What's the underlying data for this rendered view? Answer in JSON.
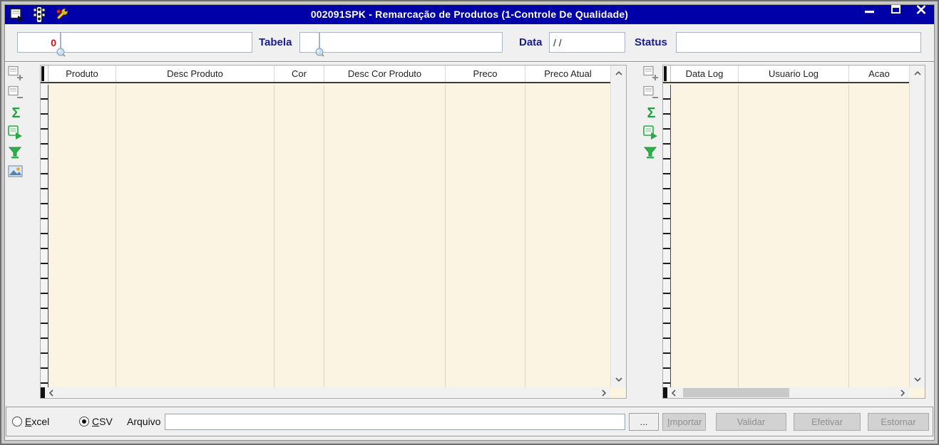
{
  "window": {
    "title": "002091SPK - Remarcação de Produtos (1-Controle De Qualidade)"
  },
  "form": {
    "code_value": "0",
    "code_desc_value": "",
    "tabela_label": "Tabela",
    "tabela_code_value": "",
    "tabela_desc_value": "",
    "data_label": "Data",
    "data_value": "/ /",
    "status_label": "Status",
    "status_value": ""
  },
  "products_grid": {
    "columns": [
      "Produto",
      "Desc Produto",
      "Cor",
      "Desc Cor Produto",
      "Preco",
      "Preco Atual"
    ],
    "rows": []
  },
  "log_grid": {
    "columns": [
      "Data Log",
      "Usuario Log",
      "Acao"
    ],
    "rows": []
  },
  "footer": {
    "excel_label": "Excel",
    "csv_label": "CSV",
    "selected_format": "CSV",
    "arquivo_label": "Arquivo",
    "arquivo_value": "",
    "browse_label": "...",
    "importar_label": "Importar",
    "validar_label": "Validar",
    "efetivar_label": "Efetivar",
    "estornar_label": "Estornar"
  },
  "icons": {
    "sum_glyph": "Σ",
    "titlebar": [
      "form-window-icon",
      "semaphore-icon",
      "wrench-icon"
    ],
    "grid_toolbar_left": [
      "add-record-icon",
      "delete-record-icon",
      "sum-icon",
      "export-record-icon",
      "filter-icon",
      "image-icon"
    ],
    "grid_toolbar_right": [
      "add-record-icon",
      "delete-record-icon",
      "sum-icon",
      "export-record-icon",
      "filter-icon"
    ]
  },
  "colors": {
    "titlebar_bg": "#0000A8",
    "label_navy": "#1B1B8F",
    "value_red": "#CC1111",
    "grid_body_cream": "#FBF4E2",
    "icon_green": "#2AA84A"
  }
}
